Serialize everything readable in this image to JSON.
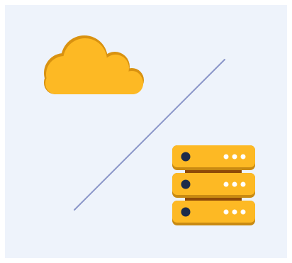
{
  "colors": {
    "panel_background": "#eef3fb",
    "cloud_fill": "#fdb924",
    "cloud_outline": "#d99210",
    "server_fill": "#fdb924",
    "server_shadow": "#c98a12",
    "server_connector": "#8f4a08",
    "server_status_dot": "#1c2b4a",
    "server_indicator_lights": "#ffffff",
    "connection_line": "#8a95c8"
  },
  "icons": {
    "cloud": "cloud-icon",
    "server": "server-rack-icon"
  },
  "server": {
    "unit_count": 3,
    "indicator_lights_per_unit": 3
  }
}
